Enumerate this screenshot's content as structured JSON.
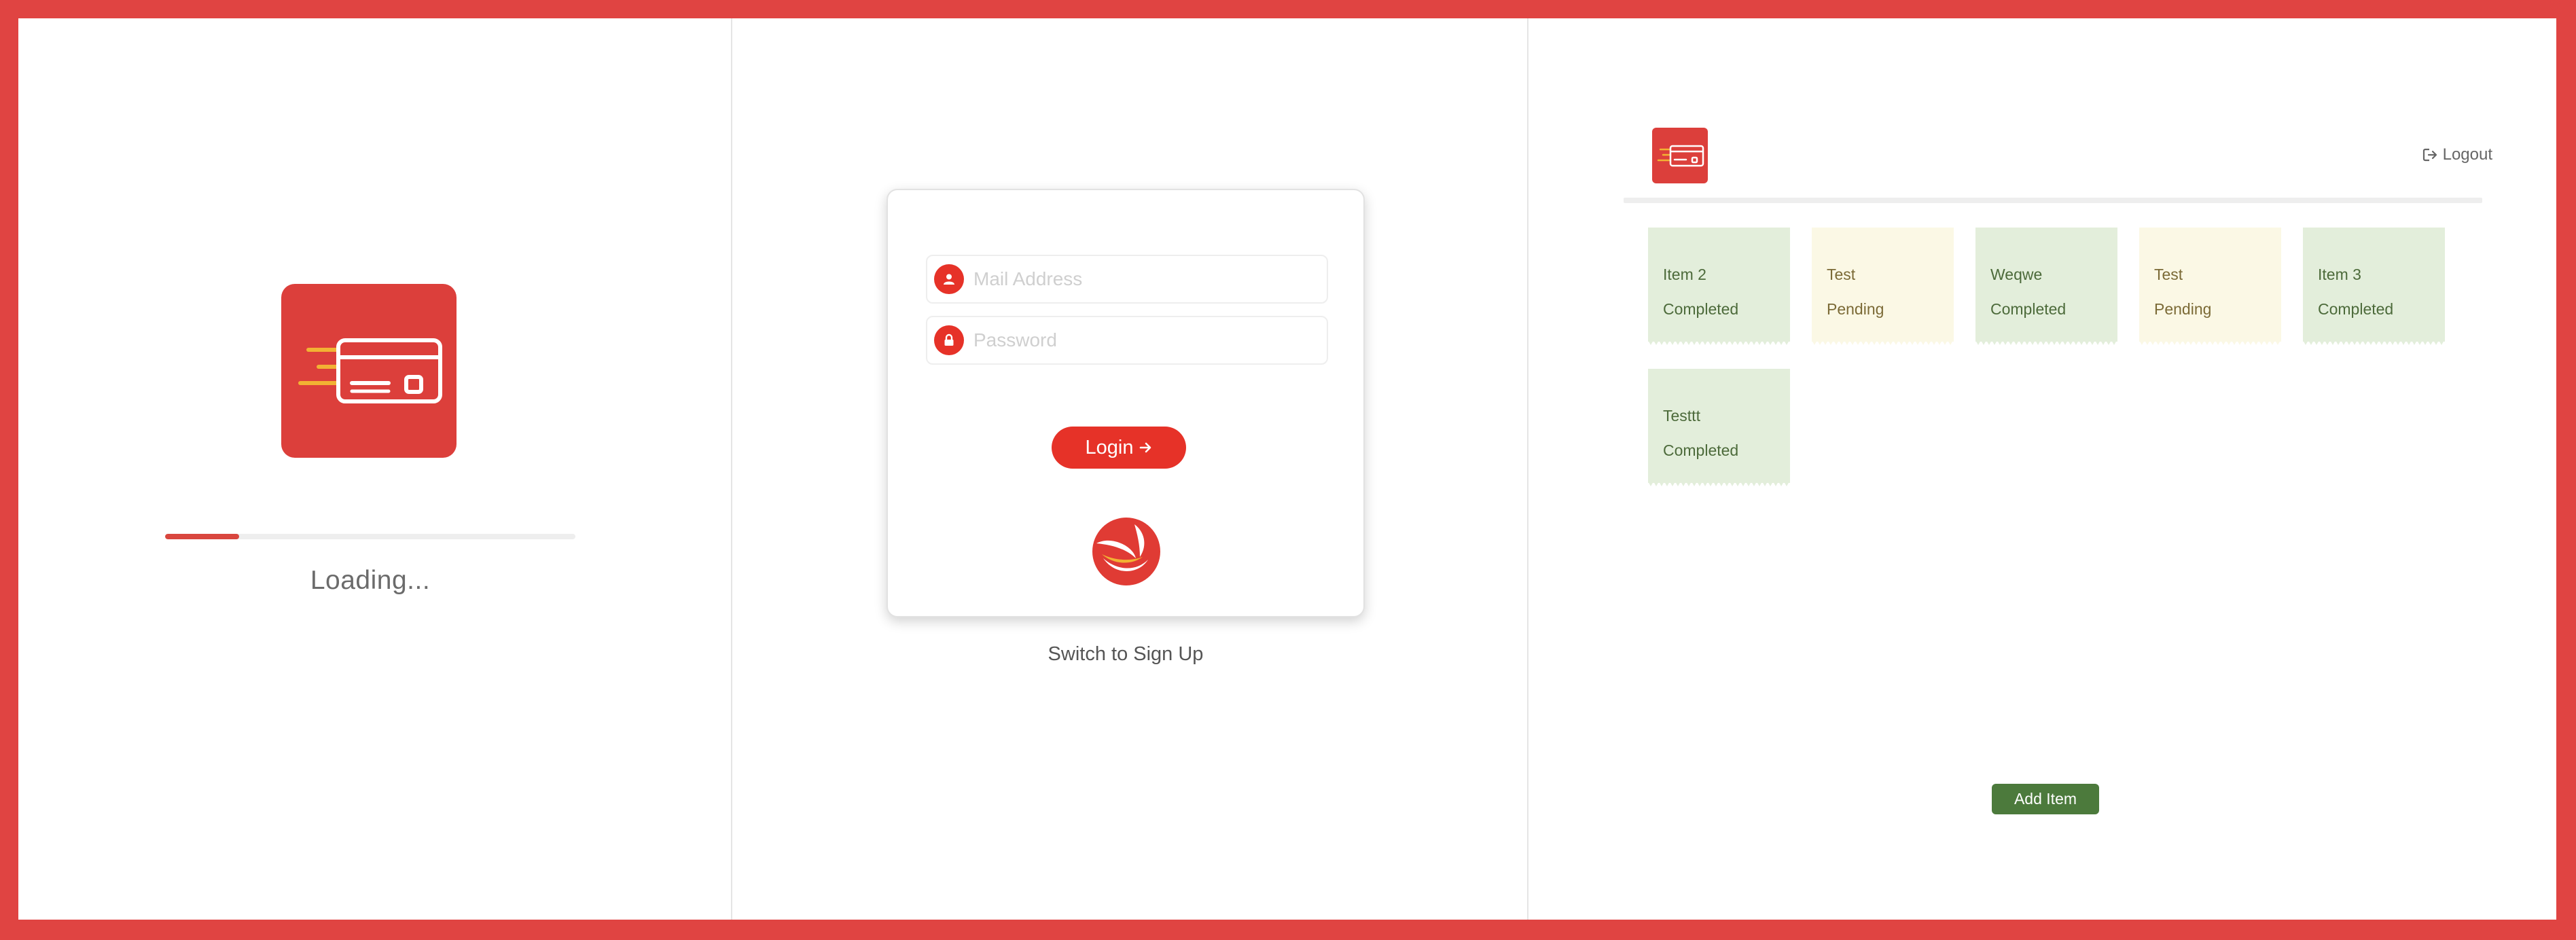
{
  "loading_screen": {
    "status_text": "Loading...",
    "progress_fraction": 0.18
  },
  "login_screen": {
    "email_placeholder": "Mail Address",
    "password_placeholder": "Password",
    "login_button_label": "Login",
    "switch_link_label": "Switch to Sign Up",
    "icons": [
      "user-icon",
      "lock-icon",
      "arrow-right-icon",
      "brand-logo"
    ]
  },
  "items_screen": {
    "logout_label": "Logout",
    "add_item_label": "Add Item",
    "items": [
      {
        "title": "Item 2",
        "status": "Completed"
      },
      {
        "title": "Test",
        "status": "Pending"
      },
      {
        "title": "Weqwe",
        "status": "Completed"
      },
      {
        "title": "Test",
        "status": "Pending"
      },
      {
        "title": "Item 3",
        "status": "Completed"
      },
      {
        "title": "Testtt",
        "status": "Completed"
      }
    ]
  },
  "colors": {
    "accent_red": "#e04442",
    "completed_bg": "#e3eedb",
    "pending_bg": "#fbf8e5",
    "add_button": "#4c7a3c"
  }
}
